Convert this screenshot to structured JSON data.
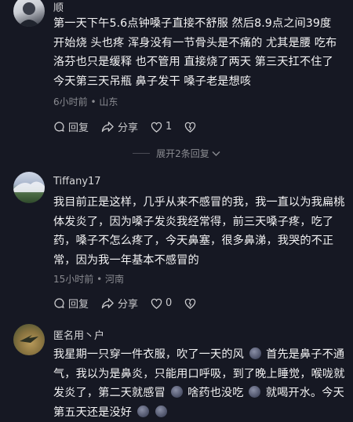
{
  "comments": [
    {
      "user": "顺",
      "text": "第一天下午5.6点钟嗓子直接不舒服 然后8.9点之间39度 开始烧 头也疼 浑身没有一节骨头是不痛的 尤其是腰 吃布洛芬也只是缓释 也不管用 直接烧了两天 第三天扛不住了 今天第三天吊瓶 鼻子发干 嗓子老是想咳",
      "meta": "6小时前 • 山东",
      "reply_label": "回复",
      "share_label": "分享",
      "like_count": "1",
      "expand_label": "展开2条回复"
    },
    {
      "user": "Tiffany17",
      "text": "我目前正是这样，几乎从来不感冒的我，我一直以为我扁桃体发炎了，因为嗓子发炎我经常得，前三天嗓子疼，吃了药，嗓子不怎么疼了，今天鼻塞，很多鼻涕，我哭的不正常，因为我一年基本不感冒的",
      "meta": "15小时前 • 河南",
      "reply_label": "回复",
      "share_label": "分享",
      "like_count": "0"
    },
    {
      "user": "匿名用丶户",
      "text_parts": [
        "我星期一只穿一件衣服，吹了一天的风",
        "首先是鼻子不通气，我以为是鼻炎，只能用口呼吸，到了晚上睡觉，喉咙就发炎了，第二天就感冒",
        "啥药也没吃",
        "就喝开水。今天第五天还是没好"
      ]
    }
  ],
  "icons": {
    "reply": "comment-bubble-icon",
    "share": "share-arrow-icon",
    "like": "heart-icon",
    "dislike": "broken-heart-icon",
    "expand": "chevron-down-icon",
    "emoji": "sad-face-emoji-icon"
  }
}
